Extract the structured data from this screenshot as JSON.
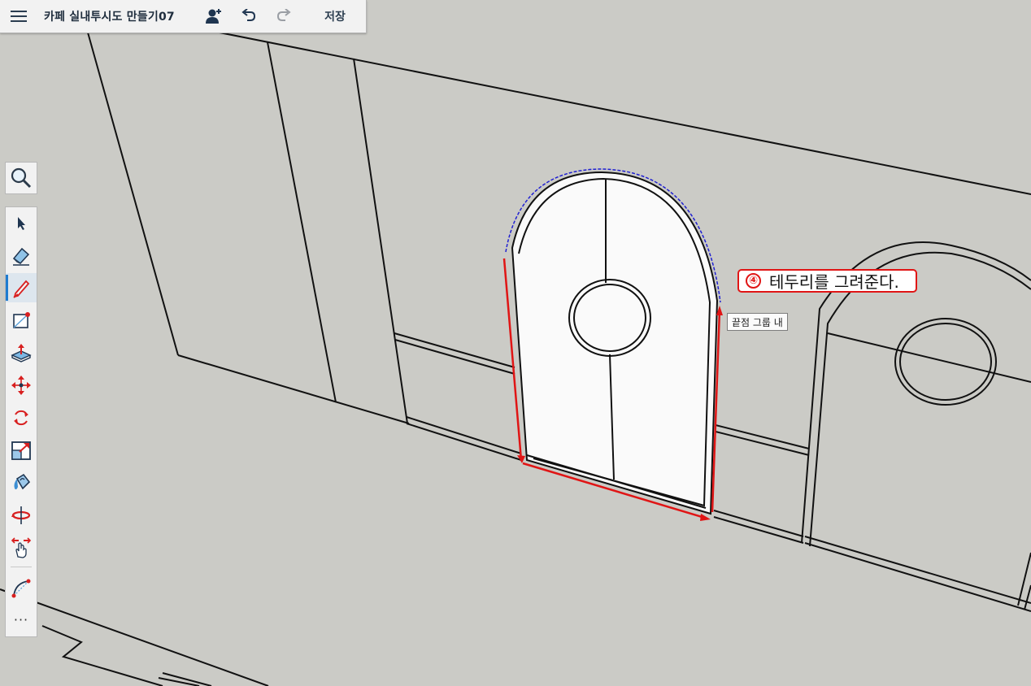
{
  "header": {
    "menu_icon": "hamburger-menu-icon",
    "title": "카페 실내투시도 만들기07",
    "share_icon": "add-user-icon",
    "undo_icon": "undo-icon",
    "redo_icon": "redo-icon",
    "save_label": "저장"
  },
  "tools": {
    "search": "search-icon",
    "items": [
      "select",
      "eraser",
      "pencil",
      "rectangle",
      "push-pull",
      "move",
      "rotate",
      "scale",
      "paint-bucket",
      "orbit",
      "pan",
      "arc"
    ],
    "active": "pencil",
    "more_label": "···"
  },
  "annotation": {
    "step_number": "④",
    "step_text": "테두리를 그려준다."
  },
  "tooltip": {
    "text": "끝점 그룹 내"
  },
  "colors": {
    "canvas": "#cbcbc6",
    "door_face": "#fafafa",
    "inference_red": "#e01515",
    "arc_blue": "#1f1fd1",
    "accent": "#1e7bd0"
  }
}
